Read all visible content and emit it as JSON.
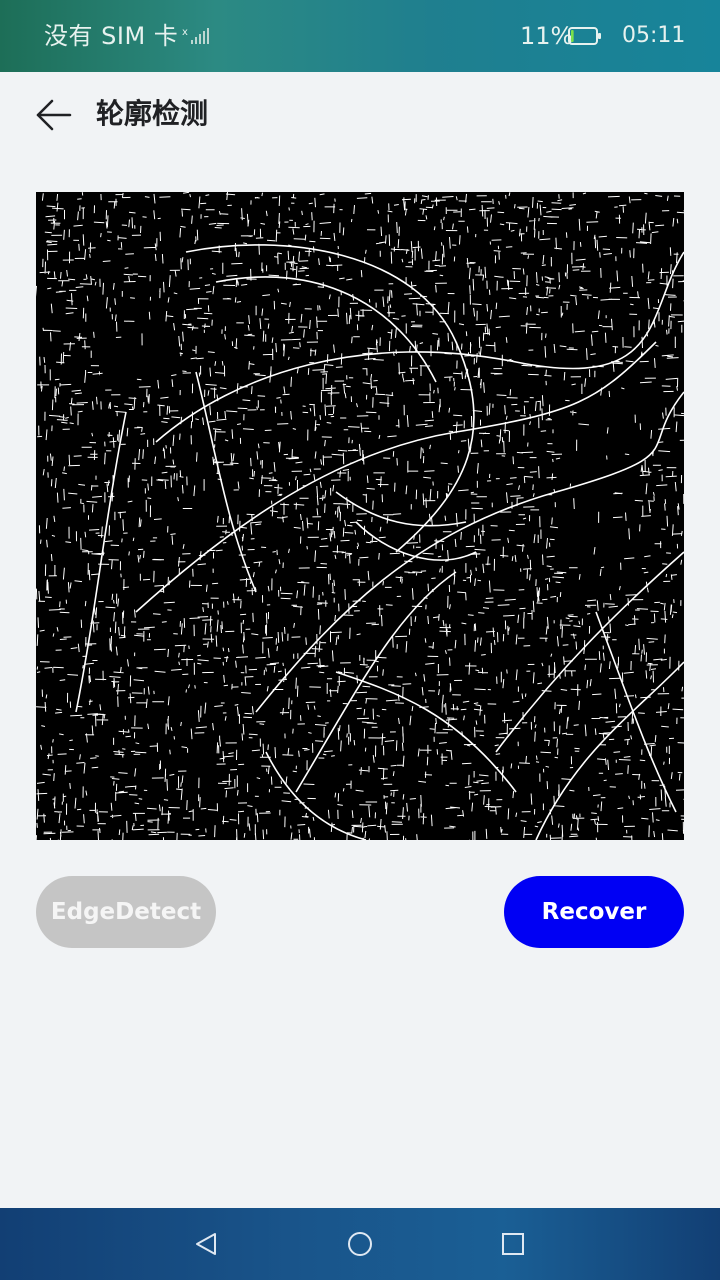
{
  "status_bar": {
    "carrier": "没有 SIM 卡",
    "battery_percent": "11%",
    "battery_level": 0.11,
    "time": "05:11",
    "icons": [
      "signal-icon",
      "battery-icon"
    ]
  },
  "header": {
    "back_icon": "arrow-left-icon",
    "title": "轮廓检测"
  },
  "image": {
    "description_type": "edge-detected-image",
    "background_color": "#000000",
    "stroke_color": "#ffffff"
  },
  "buttons": {
    "edge_detect_label": "EdgeDetect",
    "recover_label": "Recover",
    "edge_detect_color": "#c5c5c5",
    "recover_color": "#0000f4"
  },
  "nav_bar": {
    "icons": [
      "back-triangle-icon",
      "home-circle-icon",
      "recents-square-icon"
    ]
  }
}
